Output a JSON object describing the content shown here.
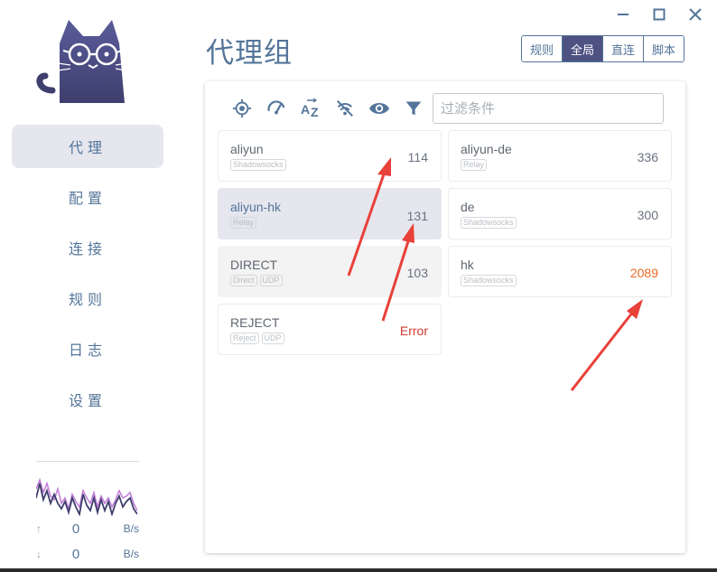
{
  "window": {
    "controls": [
      {
        "name": "minimize-icon",
        "glyph": "—"
      },
      {
        "name": "maximize-icon",
        "glyph": "▢"
      },
      {
        "name": "close-icon",
        "glyph": "✕"
      }
    ]
  },
  "sidebar": {
    "logo_icon": "cat-logo-icon",
    "items": [
      {
        "label": "代理",
        "active": true
      },
      {
        "label": "配置",
        "active": false
      },
      {
        "label": "连接",
        "active": false
      },
      {
        "label": "规则",
        "active": false
      },
      {
        "label": "日志",
        "active": false
      },
      {
        "label": "设置",
        "active": false
      }
    ],
    "traffic": {
      "up": {
        "value": "0",
        "unit": "B/s"
      },
      "down": {
        "value": "0",
        "unit": "B/s"
      }
    }
  },
  "header": {
    "title": "代理组",
    "modes": [
      {
        "label": "规则",
        "active": false
      },
      {
        "label": "全局",
        "active": true
      },
      {
        "label": "直连",
        "active": false
      },
      {
        "label": "脚本",
        "active": false
      }
    ]
  },
  "toolbar": {
    "icons": [
      "locate-icon",
      "speed-test-icon",
      "sort-az-icon",
      "hide-unavailable-icon",
      "eye-icon",
      "filter-icon"
    ],
    "filter_placeholder": "过滤条件"
  },
  "proxies": [
    {
      "name": "aliyun",
      "tags": [
        "Shadowsocks"
      ],
      "delay": "114",
      "state": "normal"
    },
    {
      "name": "aliyun-de",
      "tags": [
        "Relay"
      ],
      "delay": "336",
      "state": "normal"
    },
    {
      "name": "aliyun-hk",
      "tags": [
        "Relay"
      ],
      "delay": "131",
      "state": "selected"
    },
    {
      "name": "de",
      "tags": [
        "Shadowsocks"
      ],
      "delay": "300",
      "state": "normal"
    },
    {
      "name": "DIRECT",
      "tags": [
        "Direct",
        "UDP"
      ],
      "delay": "103",
      "state": "dim"
    },
    {
      "name": "hk",
      "tags": [
        "Shadowsocks"
      ],
      "delay": "2089",
      "state": "warn"
    },
    {
      "name": "REJECT",
      "tags": [
        "Reject",
        "UDP"
      ],
      "delay": "Error",
      "state": "error"
    }
  ],
  "colors": {
    "accent": "#4e5283",
    "text": "#54759a",
    "warn": "#ea6a24",
    "error": "#ce3a2b",
    "annotation": "#e8413a"
  }
}
